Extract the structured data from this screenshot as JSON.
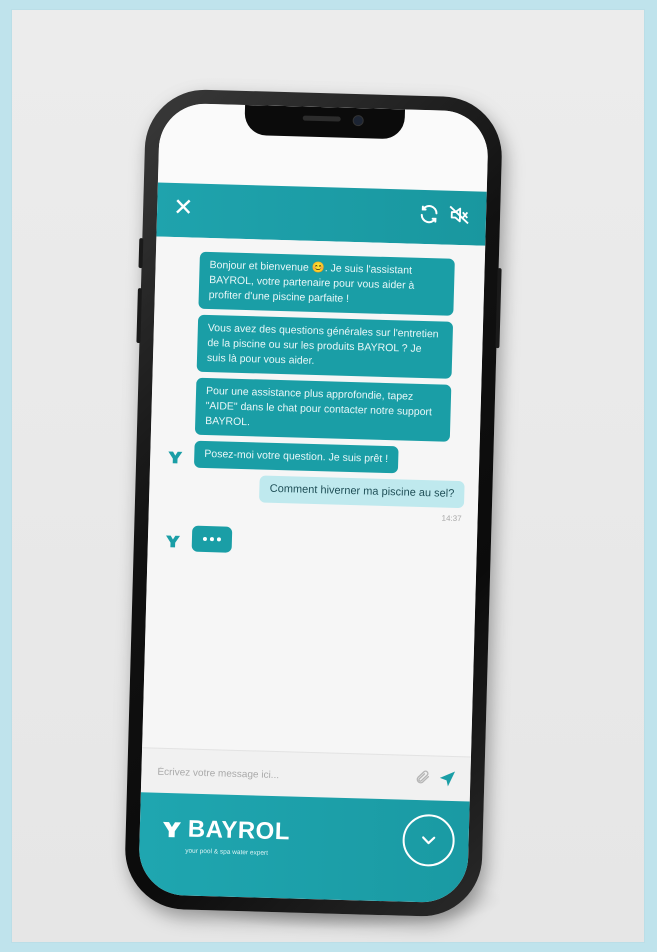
{
  "chat": {
    "messages": [
      {
        "from": "bot",
        "text": "Bonjour et bienvenue 😊. Je suis l'assistant BAYROL, votre partenaire pour vous aider à profiter d'une piscine parfaite !"
      },
      {
        "from": "bot",
        "text": "Vous avez des questions générales sur l'entretien de la piscine ou sur les produits BAYROL ? Je suis là pour vous aider."
      },
      {
        "from": "bot",
        "text": "Pour une assistance plus approfondie, tapez \"AIDE\" dans le chat pour contacter notre support BAYROL."
      },
      {
        "from": "bot",
        "text": "Posez-moi votre question. Je suis prêt !"
      }
    ],
    "user_message": "Comment hiverner ma piscine au sel?",
    "user_time": "14:37"
  },
  "header": {
    "close_icon": "close-icon",
    "refresh_icon": "refresh-icon",
    "mute_icon": "speaker-mute-icon"
  },
  "input": {
    "placeholder": "Écrivez votre message ici..."
  },
  "footer": {
    "brand": "BAYROL",
    "tagline": "your pool & spa water expert"
  },
  "colors": {
    "accent": "#1a9ea6",
    "user_bubble": "#bfe9ee"
  }
}
